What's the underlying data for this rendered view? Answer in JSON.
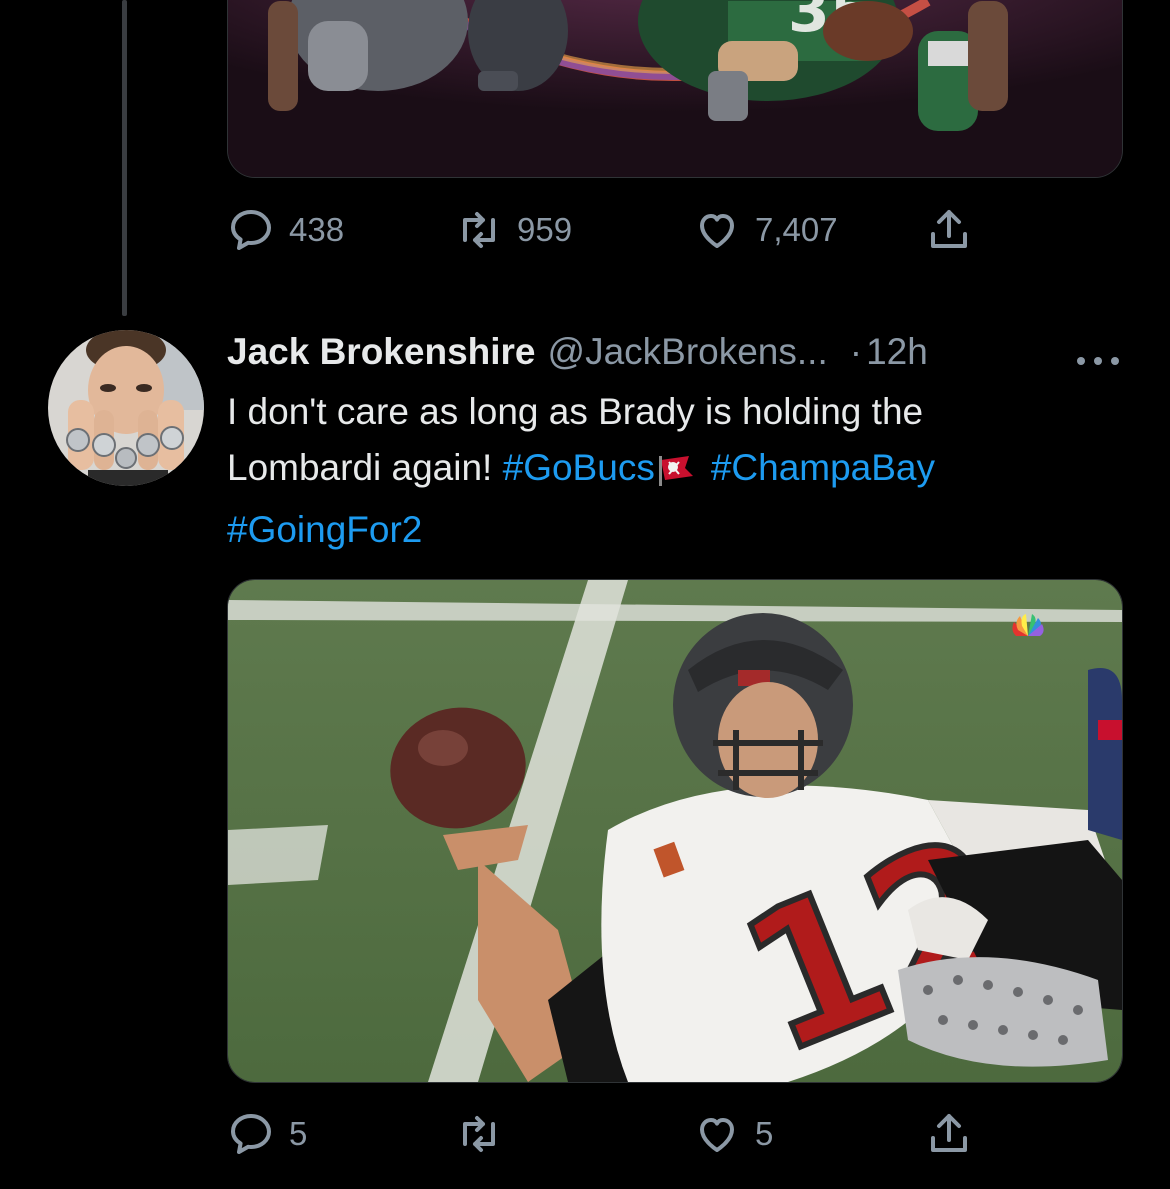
{
  "thread": {
    "previous_tweet": {
      "media_alt": "football players illustration",
      "actions": {
        "replies": "438",
        "retweets": "959",
        "likes": "7,407"
      }
    },
    "reply_tweet": {
      "author_name": "Jack Brokenshire",
      "author_handle": "@JackBrokens...",
      "separator": "·",
      "time": "12h",
      "more_icon": "more-horizontal-icon",
      "text_line1": "I don't care as long as Brady is holding the",
      "text_line2_plain": "Lombardi again! ",
      "hashtags": [
        "#GoBucs",
        "#ChampaBay",
        "#GoingFor2"
      ],
      "media_alt": "Tom Brady spinning a football on his finger",
      "actions": {
        "replies": "5",
        "retweets": "",
        "likes": "5"
      }
    }
  },
  "colors": {
    "background": "#000000",
    "text": "#e7e9ea",
    "secondary": "#8b98a5",
    "link": "#1d9bf0",
    "border": "#2f3336"
  },
  "icons": {
    "reply": "reply-bubble-icon",
    "retweet": "retweet-icon",
    "like": "heart-icon",
    "share": "share-upload-icon"
  }
}
